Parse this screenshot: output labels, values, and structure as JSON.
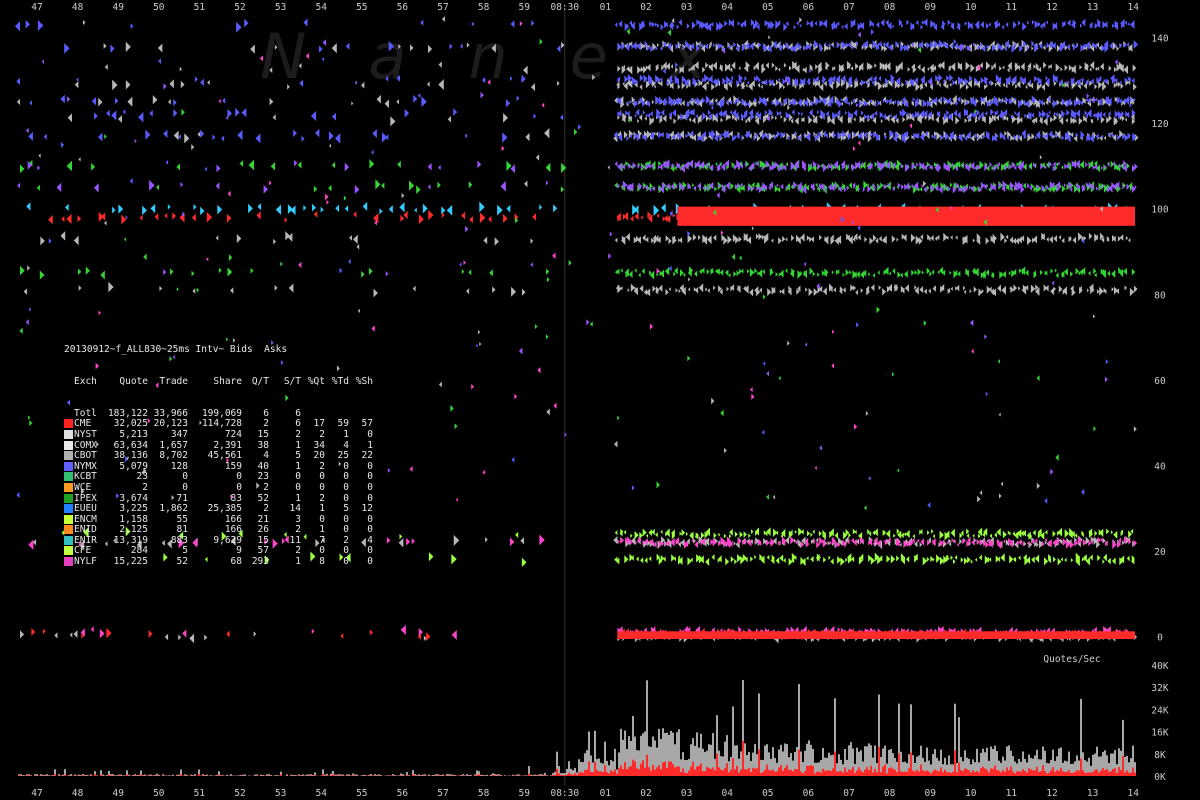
{
  "watermark": "Nanex",
  "chart_data": [
    {
      "type": "scatter",
      "title": "20130912~f_ALL830~25ms Intv~ Bids  Asks",
      "description_axis": "price",
      "x_ticks": [
        "47",
        "48",
        "49",
        "50",
        "51",
        "52",
        "53",
        "54",
        "55",
        "56",
        "57",
        "58",
        "59",
        "08:30",
        "01",
        "02",
        "03",
        "04",
        "05",
        "06",
        "07",
        "08",
        "09",
        "10",
        "11",
        "12",
        "13",
        "14"
      ],
      "y_ticks": [
        0,
        20,
        40,
        60,
        80,
        100,
        120,
        140
      ],
      "ylim": [
        -2,
        146
      ],
      "series": [
        {
          "name": "CME",
          "color": "#ff2a2a",
          "levels": [
            98,
            0.5
          ],
          "after_cut": true
        },
        {
          "name": "CBOT",
          "color": "#b8b8b8",
          "levels": [
            81,
            93,
            117,
            121,
            125,
            129,
            133,
            138,
            0,
            22
          ],
          "after_cut": true
        },
        {
          "name": "NYMX",
          "color": "#5a5aff",
          "levels": [
            143,
            138,
            130,
            125,
            122,
            117
          ],
          "after_cut": true
        },
        {
          "name": "ENCM",
          "color": "#9cff40",
          "levels": [
            18,
            24
          ],
          "after_cut": true
        },
        {
          "name": "NYLF",
          "color": "#ff44cc",
          "levels": [
            22,
            1
          ],
          "after_cut": true
        },
        {
          "name": "IPEX",
          "color": "#33d633",
          "levels": [
            105,
            110,
            85
          ],
          "after_cut": true
        },
        {
          "name": "KCBT",
          "color": "#9955ff",
          "levels": [
            110,
            105
          ],
          "after_cut": true
        },
        {
          "name": "EUEU",
          "color": "#33ccff",
          "levels": [
            100
          ],
          "after_cut": false
        }
      ]
    },
    {
      "type": "area",
      "title": "Quotes/Sec",
      "y_ticks": [
        "0K",
        "8K",
        "16K",
        "24K",
        "32K",
        "40K"
      ],
      "ylim": [
        0,
        40000
      ],
      "x_ticks": [
        "47",
        "48",
        "49",
        "50",
        "51",
        "52",
        "53",
        "54",
        "55",
        "56",
        "57",
        "58",
        "59",
        "08:30",
        "01",
        "02",
        "03",
        "04",
        "05",
        "06",
        "07",
        "08",
        "09",
        "10",
        "11",
        "12",
        "13",
        "14"
      ],
      "series": [
        {
          "name": "Total",
          "color": "#a8a8a8"
        },
        {
          "name": "CME",
          "color": "#ff2a2a"
        }
      ]
    }
  ],
  "stats_table": {
    "header1": "20130912~f_ALL830~25ms Intv~ Bids  Asks",
    "headers": [
      "Exch",
      "Quote",
      "Trade",
      "Share",
      "Q/T",
      "S/T",
      "%Qt",
      "%Td",
      "%Sh"
    ],
    "rows": [
      {
        "exch": "Totl",
        "quote": "183,122",
        "trade": "33,966",
        "share": "199,069",
        "qt": "6",
        "st": "6",
        "xqt": "",
        "xtd": "",
        "xsh": "",
        "color": ""
      },
      {
        "exch": "CME",
        "quote": "32,025",
        "trade": "20,123",
        "share": "114,728",
        "qt": "2",
        "st": "6",
        "xqt": "17",
        "xtd": "59",
        "xsh": "57",
        "color": "#ff2020"
      },
      {
        "exch": "NYST",
        "quote": "5,213",
        "trade": "347",
        "share": "724",
        "qt": "15",
        "st": "2",
        "xqt": "2",
        "xtd": "1",
        "xsh": "0",
        "color": "#e0e0e0"
      },
      {
        "exch": "COMX",
        "quote": "63,634",
        "trade": "1,657",
        "share": "2,391",
        "qt": "38",
        "st": "1",
        "xqt": "34",
        "xtd": "4",
        "xsh": "1",
        "color": "#e8e8e8"
      },
      {
        "exch": "CBOT",
        "quote": "38,136",
        "trade": "8,702",
        "share": "45,561",
        "qt": "4",
        "st": "5",
        "xqt": "20",
        "xtd": "25",
        "xsh": "22",
        "color": "#b0b0b0"
      },
      {
        "exch": "NYMX",
        "quote": "5,079",
        "trade": "128",
        "share": "159",
        "qt": "40",
        "st": "1",
        "xqt": "2",
        "xtd": "0",
        "xsh": "0",
        "color": "#6060ff"
      },
      {
        "exch": "KCBT",
        "quote": "23",
        "trade": "0",
        "share": "0",
        "qt": "23",
        "st": "0",
        "xqt": "0",
        "xtd": "0",
        "xsh": "0",
        "color": "#30c070"
      },
      {
        "exch": "WCE",
        "quote": "2",
        "trade": "0",
        "share": "0",
        "qt": "2",
        "st": "0",
        "xqt": "0",
        "xtd": "0",
        "xsh": "0",
        "color": "#ff9a20"
      },
      {
        "exch": "IPEX",
        "quote": "3,674",
        "trade": "71",
        "share": "83",
        "qt": "52",
        "st": "1",
        "xqt": "2",
        "xtd": "0",
        "xsh": "0",
        "color": "#20a020"
      },
      {
        "exch": "EUEU",
        "quote": "3,225",
        "trade": "1,862",
        "share": "25,385",
        "qt": "2",
        "st": "14",
        "xqt": "1",
        "xtd": "5",
        "xsh": "12",
        "color": "#2080ff"
      },
      {
        "exch": "ENCM",
        "quote": "1,158",
        "trade": "55",
        "share": "166",
        "qt": "21",
        "st": "3",
        "xqt": "0",
        "xtd": "0",
        "xsh": "0",
        "color": "#c8ff30"
      },
      {
        "exch": "ENID",
        "quote": "2,125",
        "trade": "81",
        "share": "166",
        "qt": "26",
        "st": "2",
        "xqt": "1",
        "xtd": "0",
        "xsh": "0",
        "color": "#ff8a20"
      },
      {
        "exch": "ENIR",
        "quote": "13,319",
        "trade": "883",
        "share": "9,629",
        "qt": "15",
        "st": "11",
        "xqt": "7",
        "xtd": "2",
        "xsh": "4",
        "color": "#30c0c0"
      },
      {
        "exch": "CFE",
        "quote": "284",
        "trade": "5",
        "share": "9",
        "qt": "57",
        "st": "2",
        "xqt": "0",
        "xtd": "0",
        "xsh": "0",
        "color": "#c0ff40"
      },
      {
        "exch": "NYLF",
        "quote": "15,225",
        "trade": "52",
        "share": "68",
        "qt": "293",
        "st": "1",
        "xqt": "8",
        "xtd": "0",
        "xsh": "0",
        "color": "#e040c0"
      }
    ]
  }
}
